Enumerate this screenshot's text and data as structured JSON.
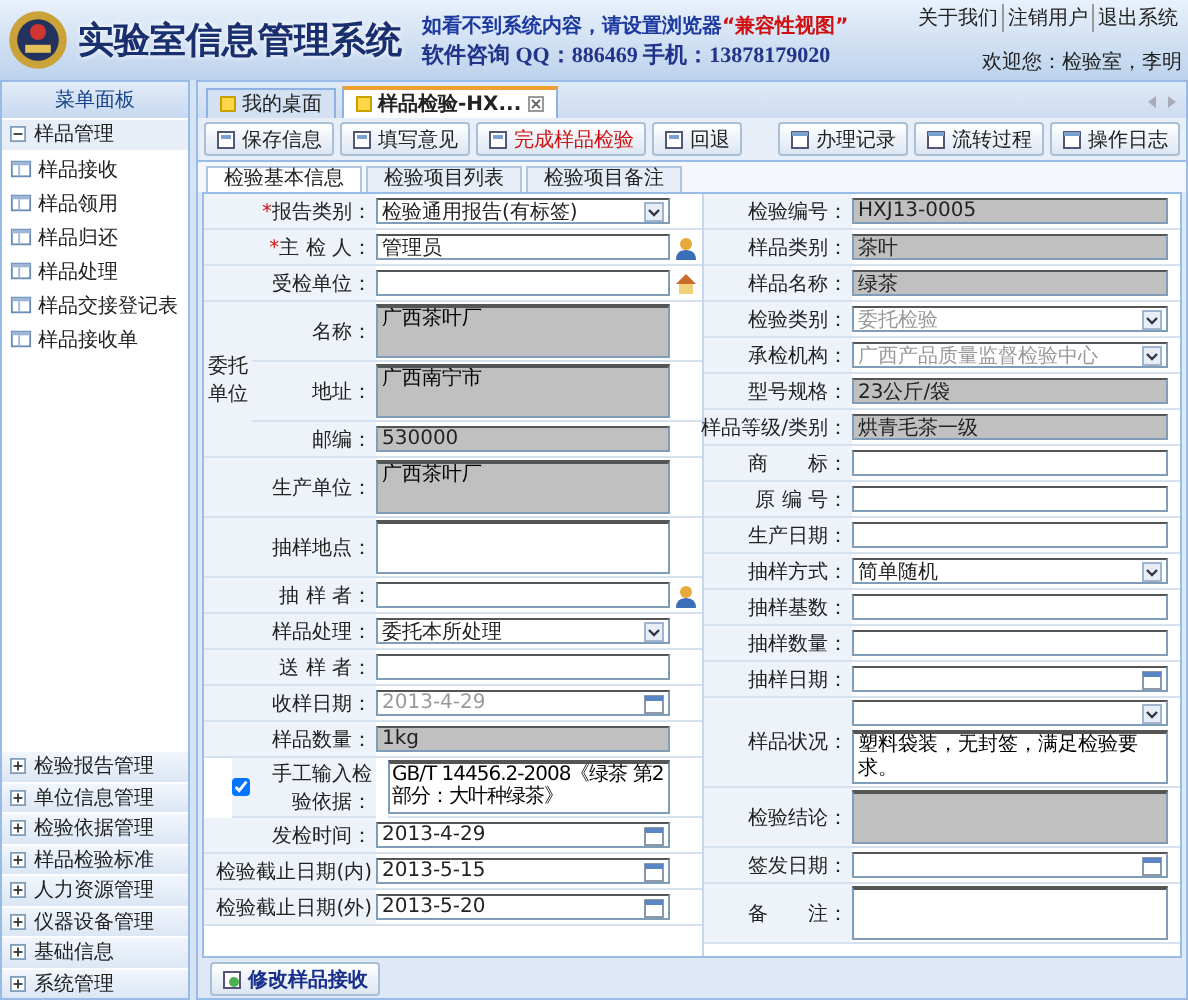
{
  "header": {
    "title": "实验室信息管理系统",
    "notice": {
      "text": "如看不到系统内容，请设置浏览器",
      "highlight": "“兼容性视图”"
    },
    "contact": "软件咨询 QQ：886469 手机：13878179020",
    "links": [
      "关于我们",
      "注销用户",
      "退出系统"
    ],
    "welcome": "欢迎您：检验室，李明"
  },
  "sidebar": {
    "title": "菜单面板",
    "groups": [
      {
        "label": "样品管理",
        "expanded": true,
        "children": [
          {
            "label": "样品接收"
          },
          {
            "label": "样品领用"
          },
          {
            "label": "样品归还"
          },
          {
            "label": "样品处理"
          },
          {
            "label": "样品交接登记表"
          },
          {
            "label": "样品接收单"
          }
        ]
      },
      {
        "label": "检验报告管理",
        "expanded": false
      },
      {
        "label": "单位信息管理",
        "expanded": false
      },
      {
        "label": "检验依据管理",
        "expanded": false
      },
      {
        "label": "样品检验标准",
        "expanded": false
      },
      {
        "label": "人力资源管理",
        "expanded": false
      },
      {
        "label": "仪器设备管理",
        "expanded": false
      },
      {
        "label": "基础信息",
        "expanded": false
      },
      {
        "label": "系统管理",
        "expanded": false
      }
    ]
  },
  "tabs": [
    {
      "label": "我的桌面",
      "selected": false,
      "closable": false
    },
    {
      "label": "样品检验-HX...",
      "selected": true,
      "closable": true
    }
  ],
  "toolbar": {
    "left": [
      {
        "label": "保存信息",
        "highlighted": false
      },
      {
        "label": "填写意见",
        "highlighted": false
      },
      {
        "label": "完成样品检验",
        "highlighted": true
      },
      {
        "label": "回退",
        "highlighted": false
      }
    ],
    "right": [
      {
        "label": "办理记录",
        "highlighted": false
      },
      {
        "label": "流转过程",
        "highlighted": false
      },
      {
        "label": "操作日志",
        "highlighted": false
      }
    ]
  },
  "subtabs": [
    {
      "label": "检验基本信息",
      "selected": true
    },
    {
      "label": "检验项目列表",
      "selected": false
    },
    {
      "label": "检验项目备注",
      "selected": false
    }
  ],
  "form": {
    "left": [
      {
        "kind": "select",
        "mark": "*",
        "label": "报告类别：",
        "value": "检验通用报告(有标签)",
        "disabled": false
      },
      {
        "kind": "person-input",
        "mark": "*",
        "label": "主 检 人：",
        "value": "管理员",
        "readonly": false
      },
      {
        "kind": "building-input",
        "label": "受检单位：",
        "readonly": false
      },
      {
        "kind": "group",
        "label": "委托单位",
        "rows": [
          {
            "kind": "textarea",
            "label": "名称：",
            "value": "广西茶叶厂",
            "readonly": true
          },
          {
            "kind": "textarea",
            "label": "地址：",
            "value": "广西南宁市",
            "readonly": true
          },
          {
            "kind": "input",
            "label": "邮编：",
            "value": "530000",
            "readonly": true
          }
        ]
      },
      {
        "kind": "textarea",
        "label": "生产单位：",
        "value": "广西茶叶厂",
        "readonly": true
      },
      {
        "kind": "textarea",
        "label": "抽样地点：",
        "readonly": false
      },
      {
        "kind": "person-input",
        "label": "抽 样 者：",
        "readonly": false
      },
      {
        "kind": "select",
        "label": "样品处理：",
        "value": "委托本所处理",
        "disabled": false
      },
      {
        "kind": "input",
        "label": "送 样 者：",
        "readonly": false
      },
      {
        "kind": "date",
        "label": "收样日期：",
        "value": "2013-4-29",
        "disabled": true
      },
      {
        "kind": "input",
        "label": "样品数量：",
        "value": "1kg",
        "readonly": true
      },
      {
        "kind": "check-textarea",
        "label": "手工输入检验依据：",
        "checked": true,
        "value": "GB/T 14456.2-2008《绿茶 第2部分：大叶种绿茶》",
        "readonly": false
      },
      {
        "kind": "date",
        "label": "发检时间：",
        "value": "2013-4-29",
        "disabled": false
      },
      {
        "kind": "date",
        "label": "检验截止日期(内)",
        "value": "2013-5-15",
        "disabled": false
      },
      {
        "kind": "date",
        "label": "检验截止日期(外)",
        "value": "2013-5-20",
        "disabled": false
      }
    ],
    "right": [
      {
        "kind": "input",
        "label": "检验编号：",
        "value": "HXJ13-0005",
        "readonly": true
      },
      {
        "kind": "input",
        "label": "样品类别：",
        "value": "茶叶",
        "readonly": true
      },
      {
        "kind": "input",
        "label": "样品名称：",
        "value": "绿茶",
        "readonly": true
      },
      {
        "kind": "select",
        "label": "检验类别：",
        "value": "委托检验",
        "disabled": true
      },
      {
        "kind": "select",
        "label": "承检机构：",
        "value": "广西产品质量监督检验中心",
        "disabled": true
      },
      {
        "kind": "input",
        "label": "型号规格：",
        "value": "23公斤/袋",
        "readonly": true
      },
      {
        "kind": "input",
        "label": "样品等级/类别：",
        "value": "烘青毛茶一级",
        "readonly": true
      },
      {
        "kind": "input",
        "label": "商　　标：",
        "readonly": false
      },
      {
        "kind": "input",
        "label": "原 编 号：",
        "readonly": false
      },
      {
        "kind": "input",
        "label": "生产日期：",
        "readonly": false
      },
      {
        "kind": "select",
        "label": "抽样方式：",
        "value": "简单随机",
        "disabled": false
      },
      {
        "kind": "input",
        "label": "抽样基数：",
        "readonly": false
      },
      {
        "kind": "input",
        "label": "抽样数量：",
        "readonly": false
      },
      {
        "kind": "date",
        "label": "抽样日期："
      },
      {
        "kind": "select-textarea",
        "label": "样品状况：",
        "value": "塑料袋装，无封签，满足检验要求。",
        "readonly": false
      },
      {
        "kind": "textarea",
        "label": "检验结论：",
        "readonly": true
      },
      {
        "kind": "date",
        "label": "签发日期："
      },
      {
        "kind": "textarea",
        "label": "备　　注：",
        "readonly": false
      }
    ]
  },
  "footer_button": "修改样品接收"
}
